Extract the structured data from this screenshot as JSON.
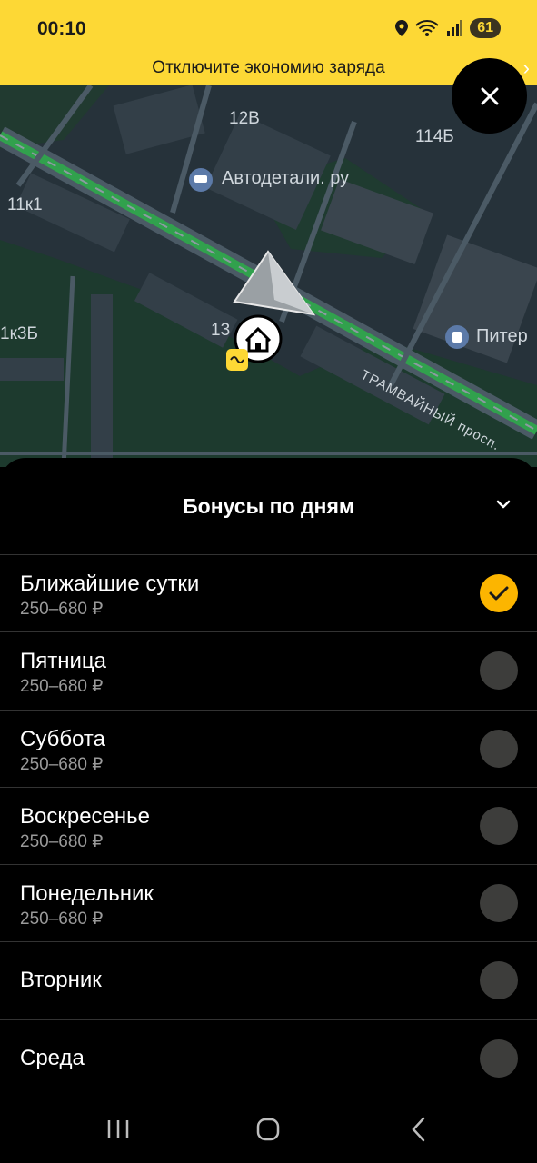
{
  "status_bar": {
    "time": "00:10",
    "battery": "61"
  },
  "banner": {
    "text": "Отключите экономию заряда"
  },
  "map": {
    "labels": {
      "building_12v": "12В",
      "building_114b": "114Б",
      "building_11k1": "11к1",
      "building_1k3b": "1к3Б",
      "building_13": "13",
      "poi_autoparts": "Автодетали. ру",
      "poi_piter": "Питер",
      "street": "ТРАМВАЙНЫЙ просп."
    }
  },
  "sheet": {
    "title": "Бонусы по дням",
    "days": [
      {
        "name": "Ближайшие сутки",
        "price": "250–680 ₽",
        "selected": true
      },
      {
        "name": "Пятница",
        "price": "250–680 ₽",
        "selected": false
      },
      {
        "name": "Суббота",
        "price": "250–680 ₽",
        "selected": false
      },
      {
        "name": "Воскресенье",
        "price": "250–680 ₽",
        "selected": false
      },
      {
        "name": "Понедельник",
        "price": "250–680 ₽",
        "selected": false
      },
      {
        "name": "Вторник",
        "selected": false
      },
      {
        "name": "Среда",
        "selected": false
      }
    ]
  },
  "colors": {
    "accent": "#fdd835",
    "selected": "#fcb500",
    "route": "#2fa84a"
  }
}
